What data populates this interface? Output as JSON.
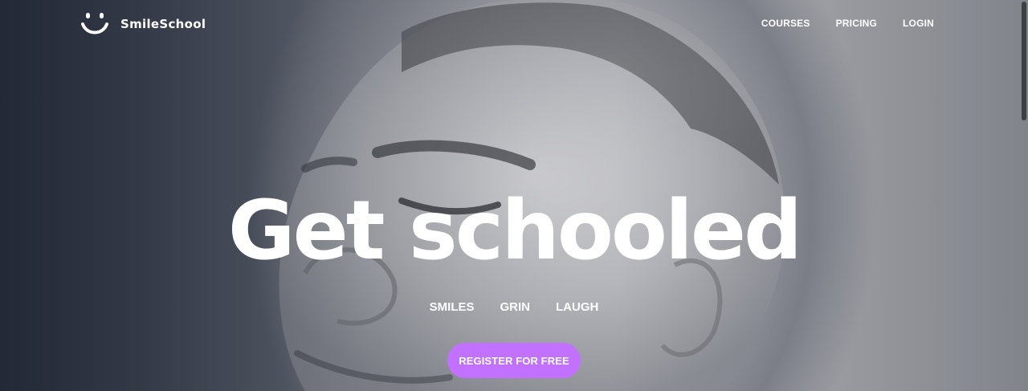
{
  "brand": {
    "name": "SmileSchool",
    "logo_icon": "smiley-face-icon"
  },
  "nav": {
    "items": [
      {
        "label": "COURSES"
      },
      {
        "label": "PRICING"
      },
      {
        "label": "LOGIN"
      }
    ]
  },
  "hero": {
    "headline": "Get schooled",
    "tags": [
      "SMILES",
      "GRIN",
      "LAUGH"
    ],
    "cta_label": "REGISTER FOR FREE",
    "background_image": "grayscale-portrait-smiling-woman"
  },
  "colors": {
    "cta_background": "#c271ff",
    "text": "#ffffff",
    "overlay": "#1d232d"
  }
}
